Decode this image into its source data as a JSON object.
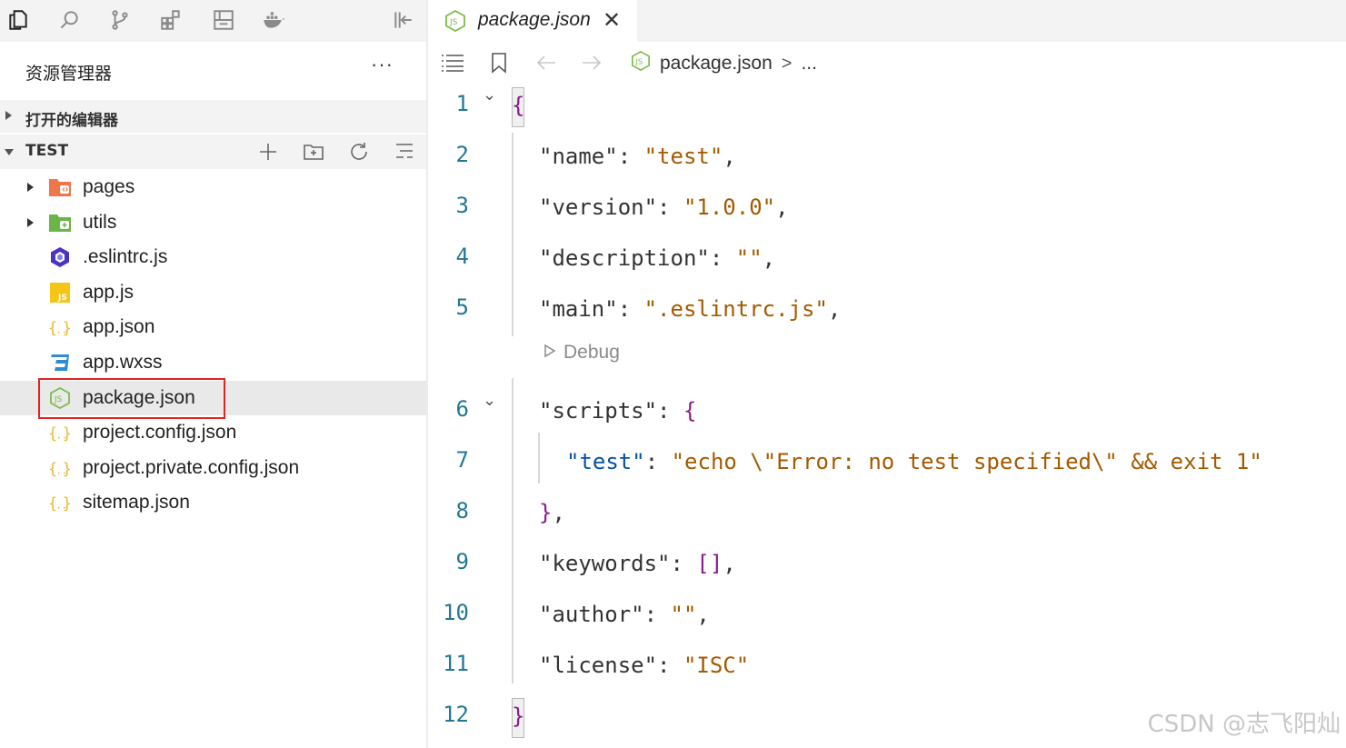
{
  "activity_bar": {
    "icons": [
      "files-icon",
      "search-icon",
      "source-control-icon",
      "extensions-icon",
      "layout-icon",
      "docker-icon",
      "collapse-panel-icon"
    ]
  },
  "explorer": {
    "title": "资源管理器",
    "more": "···",
    "open_editors_label": "打开的编辑器",
    "project_label": "TEST",
    "files": [
      {
        "name": "pages",
        "type": "folder"
      },
      {
        "name": "utils",
        "type": "folder"
      },
      {
        "name": ".eslintrc.js",
        "type": "eslint"
      },
      {
        "name": "app.js",
        "type": "js"
      },
      {
        "name": "app.json",
        "type": "json"
      },
      {
        "name": "app.wxss",
        "type": "css"
      },
      {
        "name": "package.json",
        "type": "node",
        "selected": true
      },
      {
        "name": "project.config.json",
        "type": "json"
      },
      {
        "name": "project.private.config.json",
        "type": "json"
      },
      {
        "name": "sitemap.json",
        "type": "json"
      }
    ]
  },
  "editor": {
    "tab_title": "package.json",
    "tab_close": "✕",
    "breadcrumb": {
      "file": "package.json",
      "sep": ">",
      "more": "..."
    },
    "codelens": "Debug",
    "line_numbers": [
      "1",
      "2",
      "3",
      "4",
      "5",
      "6",
      "7",
      "8",
      "9",
      "10",
      "11",
      "12"
    ]
  },
  "colors": {
    "accent_red": "#e02424",
    "string": "#a45a00",
    "key_nested": "#0451a5",
    "line_number": "#237893"
  },
  "watermark": "CSDN @志飞阳灿"
}
